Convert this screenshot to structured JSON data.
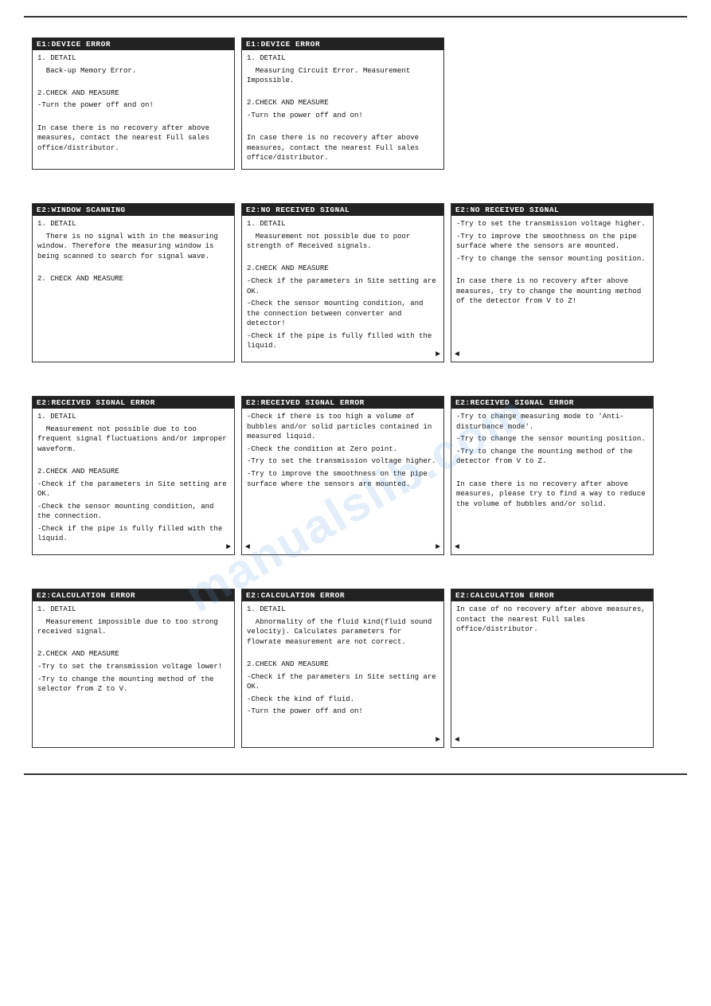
{
  "watermark": "manualslib.com",
  "topLine": true,
  "bottomLine": true,
  "rows": [
    {
      "id": "row1",
      "cards": [
        {
          "id": "e1-device-error-1",
          "header": "E1:DEVICE ERROR",
          "body": [
            "1. DETAIL",
            "  Back-up Memory Error.",
            "",
            "2.CHECK AND MEASURE",
            "-Turn the power off and on!",
            "",
            "In case there is no recovery after above measures, contact the nearest Full sales office/distributor."
          ],
          "continuationRight": false,
          "continuationLeft": false
        },
        {
          "id": "e1-device-error-2",
          "header": "E1:DEVICE ERROR",
          "body": [
            "1. DETAIL",
            "  Measuring Circuit Error. Measurement Impossible.",
            "",
            "2.CHECK AND MEASURE",
            "-Turn the power off and on!",
            "",
            "In case there is no recovery after above measures, contact the nearest Full sales office/distributor."
          ],
          "continuationRight": false,
          "continuationLeft": false
        }
      ]
    },
    {
      "id": "row2",
      "cards": [
        {
          "id": "e2-window-scanning",
          "header": "E2:WINDOW SCANNING",
          "body": [
            "1. DETAIL",
            "  There is no signal with in the measuring window. Therefore the measuring window is being scanned to search for signal wave.",
            "",
            "2. CHECK AND MEASURE"
          ],
          "continuationRight": false,
          "continuationLeft": false
        },
        {
          "id": "e2-no-received-signal-1",
          "header": "E2:NO RECEIVED SIGNAL",
          "body": [
            "1. DETAIL",
            "  Measurement not possible due to poor strength of Received signals.",
            "",
            "2.CHECK AND MEASURE",
            "-Check if the parameters in Site setting are OK.",
            "-Check the sensor mounting condition, and the connection between converter and detector!",
            "-Check if the pipe is fully filled with the liquid."
          ],
          "continuationRight": true,
          "continuationLeft": false
        },
        {
          "id": "e2-no-received-signal-2",
          "header": "E2:NO RECEIVED SIGNAL",
          "body": [
            "-Try to set the transmission voltage higher.",
            "-Try to improve the smoothness on the pipe surface where the sensors are mounted.",
            "-Try to change the sensor mounting position.",
            "",
            "In case there is no recovery after above measures, try to change the mounting method of the detector from V to Z!"
          ],
          "continuationRight": false,
          "continuationLeft": true
        }
      ]
    },
    {
      "id": "row3",
      "cards": [
        {
          "id": "e2-received-signal-error-1",
          "header": "E2:RECEIVED SIGNAL ERROR",
          "body": [
            "1. DETAIL",
            "  Measurement not possible due to too frequent signal fluctuations and/or improper waveform.",
            "",
            "2.CHECK AND MEASURE",
            "-Check if the parameters in Site setting are OK.",
            "-Check the sensor mounting condition, and the connection.",
            "-Check if the pipe is fully filled with the liquid."
          ],
          "continuationRight": true,
          "continuationLeft": false
        },
        {
          "id": "e2-received-signal-error-2",
          "header": "E2:RECEIVED SIGNAL ERROR",
          "body": [
            "-Check if there is too high a volume of bubbles and/or solid particles contained in measured liquid.",
            "-Check the condition at Zero point.",
            "-Try to set the transmission voltage higher.",
            "-Try to improve the smoothness on the pipe surface where the sensors are mounted."
          ],
          "continuationRight": true,
          "continuationLeft": true
        },
        {
          "id": "e2-received-signal-error-3",
          "header": "E2:RECEIVED SIGNAL ERROR",
          "body": [
            "-Try to change measuring mode to 'Anti-disturbance mode'.",
            "-Try to change the sensor mounting position.",
            "-Try to change the mounting method of the detector from V to Z.",
            "",
            "In case there is no recovery after above measures, please try to find a way to reduce the volume of bubbles and/or solid."
          ],
          "continuationRight": false,
          "continuationLeft": true
        }
      ]
    },
    {
      "id": "row4",
      "cards": [
        {
          "id": "e2-calculation-error-1",
          "header": "E2:CALCULATION ERROR",
          "body": [
            "1. DETAIL",
            "  Measurement impossible due to too strong received signal.",
            "",
            "2.CHECK AND MEASURE",
            "-Try to set the transmission voltage lower!",
            "-Try to change the mounting method of the selector from Z to V."
          ],
          "continuationRight": false,
          "continuationLeft": false
        },
        {
          "id": "e2-calculation-error-2",
          "header": "E2:CALCULATION ERROR",
          "body": [
            "1. DETAIL",
            "  Abnormality of the fluid kind(fluid sound velocity). Calculates parameters for flowrate measurement are not correct.",
            "",
            "2.CHECK AND MEASURE",
            "-Check if the parameters in Site setting are OK.",
            "-Check the kind of fluid.",
            "-Turn the power off and on!"
          ],
          "continuationRight": true,
          "continuationLeft": false
        },
        {
          "id": "e2-calculation-error-3",
          "header": "E2:CALCULATION ERROR",
          "body": [
            "In case of no recovery after above measures, contact the nearest Full sales office/distributor."
          ],
          "continuationRight": false,
          "continuationLeft": true
        }
      ]
    }
  ]
}
